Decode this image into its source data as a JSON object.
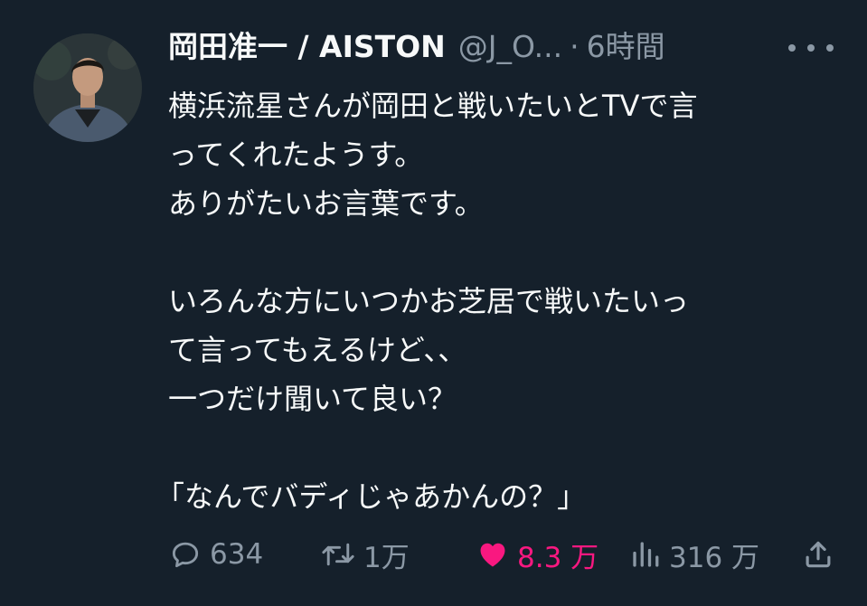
{
  "tweet": {
    "author_name": "岡田准一 / AISTON",
    "handle": "@J_O...",
    "separator": "·",
    "time": "6時間",
    "lines": [
      "横浜流星さんが岡田と戦いたいとTVで言",
      "ってくれたようす。",
      "ありがたいお言葉です。",
      "",
      "いろんな方にいつかお芝居で戦いたいっ",
      "て言ってもえるけど、、",
      "一つだけ聞いて良い？",
      "",
      "「なんでバディじゃあかんの？」"
    ]
  },
  "actions": {
    "replies": "634",
    "retweets": "1万",
    "likes": "8.3 万",
    "views": "316 万"
  },
  "icons": {
    "reply": "reply-bubble-icon",
    "retweet": "retweet-icon",
    "like": "heart-icon",
    "views": "views-bar-chart-icon",
    "share": "share-upload-icon",
    "more": "more-dots-icon"
  },
  "colors": {
    "background": "#15202b",
    "text": "#f7f9f9",
    "muted": "#8b98a5",
    "like": "#f91880"
  }
}
